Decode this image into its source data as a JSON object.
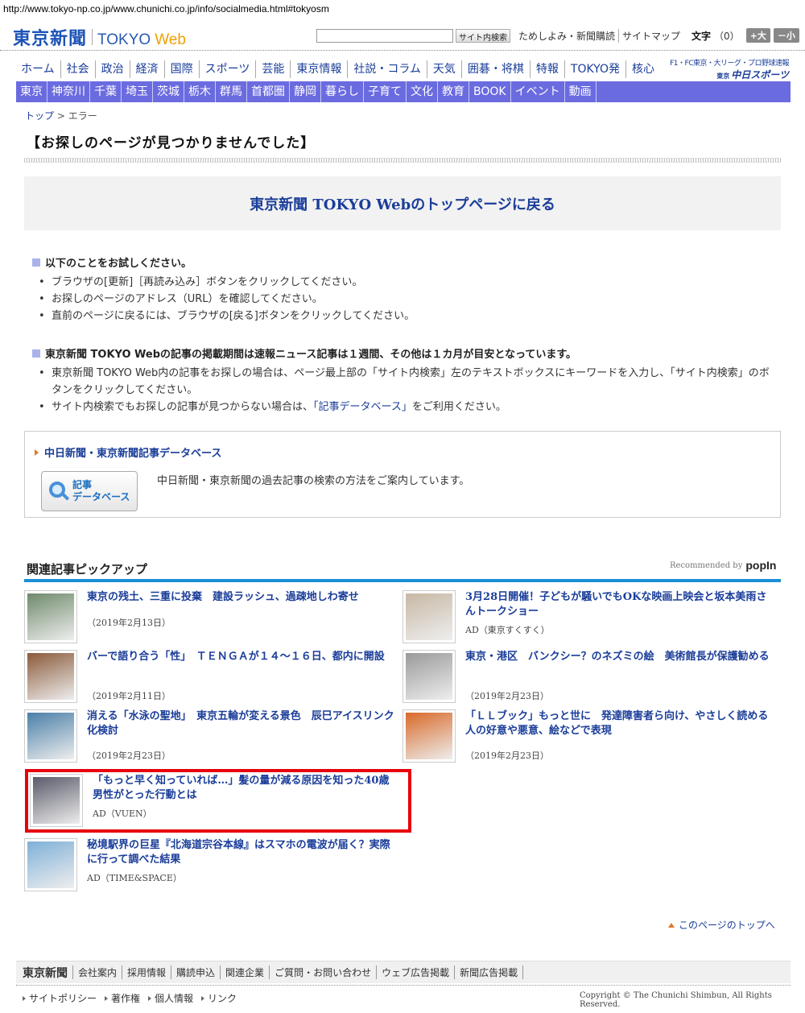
{
  "browser": {
    "url": "http://www.tokyo-np.co.jp/www.chunichi.co.jp/info/socialmedia.html#tokyosm"
  },
  "header": {
    "logo_jp": "東京新聞",
    "logo_en": "TOKYO",
    "logo_web": "Web",
    "search_button": "サイト内検索",
    "links": [
      "ためしよみ・新聞購読",
      "サイトマップ"
    ],
    "font_label": "文字",
    "font_count": "（0）",
    "size_up": "+大",
    "size_down": "－小"
  },
  "nav_main": [
    "ホーム",
    "社会",
    "政治",
    "経済",
    "国際",
    "スポーツ",
    "芸能",
    "東京情報",
    "社説・コラム",
    "天気",
    "囲碁・将棋",
    "特報",
    "TOKYO発",
    "核心"
  ],
  "chunichi_sports": {
    "small": "F1・FC東京・大リーグ・プロ野球速報",
    "prefix": "東京",
    "name": "中日スポーツ"
  },
  "nav_sub": [
    "東京",
    "神奈川",
    "千葉",
    "埼玉",
    "茨城",
    "栃木",
    "群馬",
    "首都圏",
    "静岡",
    "暮らし",
    "子育て",
    "文化",
    "教育",
    "BOOK",
    "イベント",
    "動画"
  ],
  "breadcrumb": {
    "top": "トップ",
    "sep": " > ",
    "current": "エラー"
  },
  "page_title": "【お探しのページが見つかりませんでした】",
  "back_link": "東京新聞 TOKYO Webのトップページに戻る",
  "section1": {
    "heading": "以下のことをお試しください。",
    "items": [
      "ブラウザの[更新]［再読み込み］ボタンをクリックしてください。",
      "お探しのページのアドレス（URL）を確認してください。",
      "直前のページに戻るには、ブラウザの[戻る]ボタンをクリックしてください。"
    ]
  },
  "section2": {
    "heading": "東京新聞 TOKYO Webの記事の掲載期間は速報ニュース記事は１週間、その他は１カ月が目安となっています。",
    "item1": "東京新聞 TOKYO Web内の記事をお探しの場合は、ページ最上部の「サイト内検索」左のテキストボックスにキーワードを入力し、「サイト内検索」のボタンをクリックしてください。",
    "item2_before": "サイト内検索でもお探しの記事が見つからない場合は、",
    "item2_link": "「記事データベース」",
    "item2_after": "をご利用ください。"
  },
  "db_box": {
    "title": "中日新聞・東京新聞記事データベース",
    "button_line1": "記事",
    "button_line2": "データベース",
    "description": "中日新聞・東京新聞の過去記事の検索の方法をご案内しています。"
  },
  "related": {
    "heading": "関連記事ピックアップ",
    "recommended_by": "Recommended by",
    "rec_logo": "popIn",
    "articles": [
      {
        "title": "東京の残土、三重に投棄　建設ラッシュ、過疎地しわ寄せ",
        "meta": "（2019年2月13日）",
        "thumb_color": "#6f8a6b"
      },
      {
        "title": "3月28日開催！子どもが騒いでもOKな映画上映会と坂本美雨さんトークショー",
        "meta": "AD（東京すくすく）",
        "thumb_color": "#c7b8a4"
      },
      {
        "title": "バーで語り合う「性」　ＴＥＮＧＡが１４～１６日、都内に開設",
        "meta": "（2019年2月11日）",
        "thumb_color": "#8a5a3a"
      },
      {
        "title": "東京・港区　バンクシー？のネズミの絵　美術館長が保護勧める",
        "meta": "（2019年2月23日）",
        "thumb_color": "#9a9a9a"
      },
      {
        "title": "消える「水泳の聖地」　東京五輪が変える景色　辰巳アイスリンク化検討",
        "meta": "（2019年2月23日）",
        "thumb_color": "#4a7fa8"
      },
      {
        "title": "「ＬＬブック」もっと世に　発達障害者ら向け、やさしく読める　人の好意や悪意、絵などで表現",
        "meta": "（2019年2月23日）",
        "thumb_color": "#d86a2a"
      },
      {
        "title": "「もっと早く知っていれば…」髪の量が減る原因を知った40歳男性がとった行動とは",
        "meta": "AD（VUEN）",
        "thumb_color": "#5a5a6a"
      },
      {
        "title": "秘境駅界の巨星『北海道宗谷本線』はスマホの電波が届く？実際に行って調べた結果",
        "meta": "AD（TIME&SPACE）",
        "thumb_color": "#7fb0d8"
      }
    ]
  },
  "page_top": "このページのトップへ",
  "footer": {
    "logo": "東京新聞",
    "links": [
      "会社案内",
      "採用情報",
      "購読申込",
      "関連企業",
      "ご質問・お問い合わせ",
      "ウェブ広告掲載",
      "新聞広告掲載"
    ],
    "policy": [
      "サイトポリシー",
      "著作権",
      "個人情報",
      "リンク"
    ],
    "copyright": "Copyright © The Chunichi Shimbun, All Rights Reserved."
  }
}
